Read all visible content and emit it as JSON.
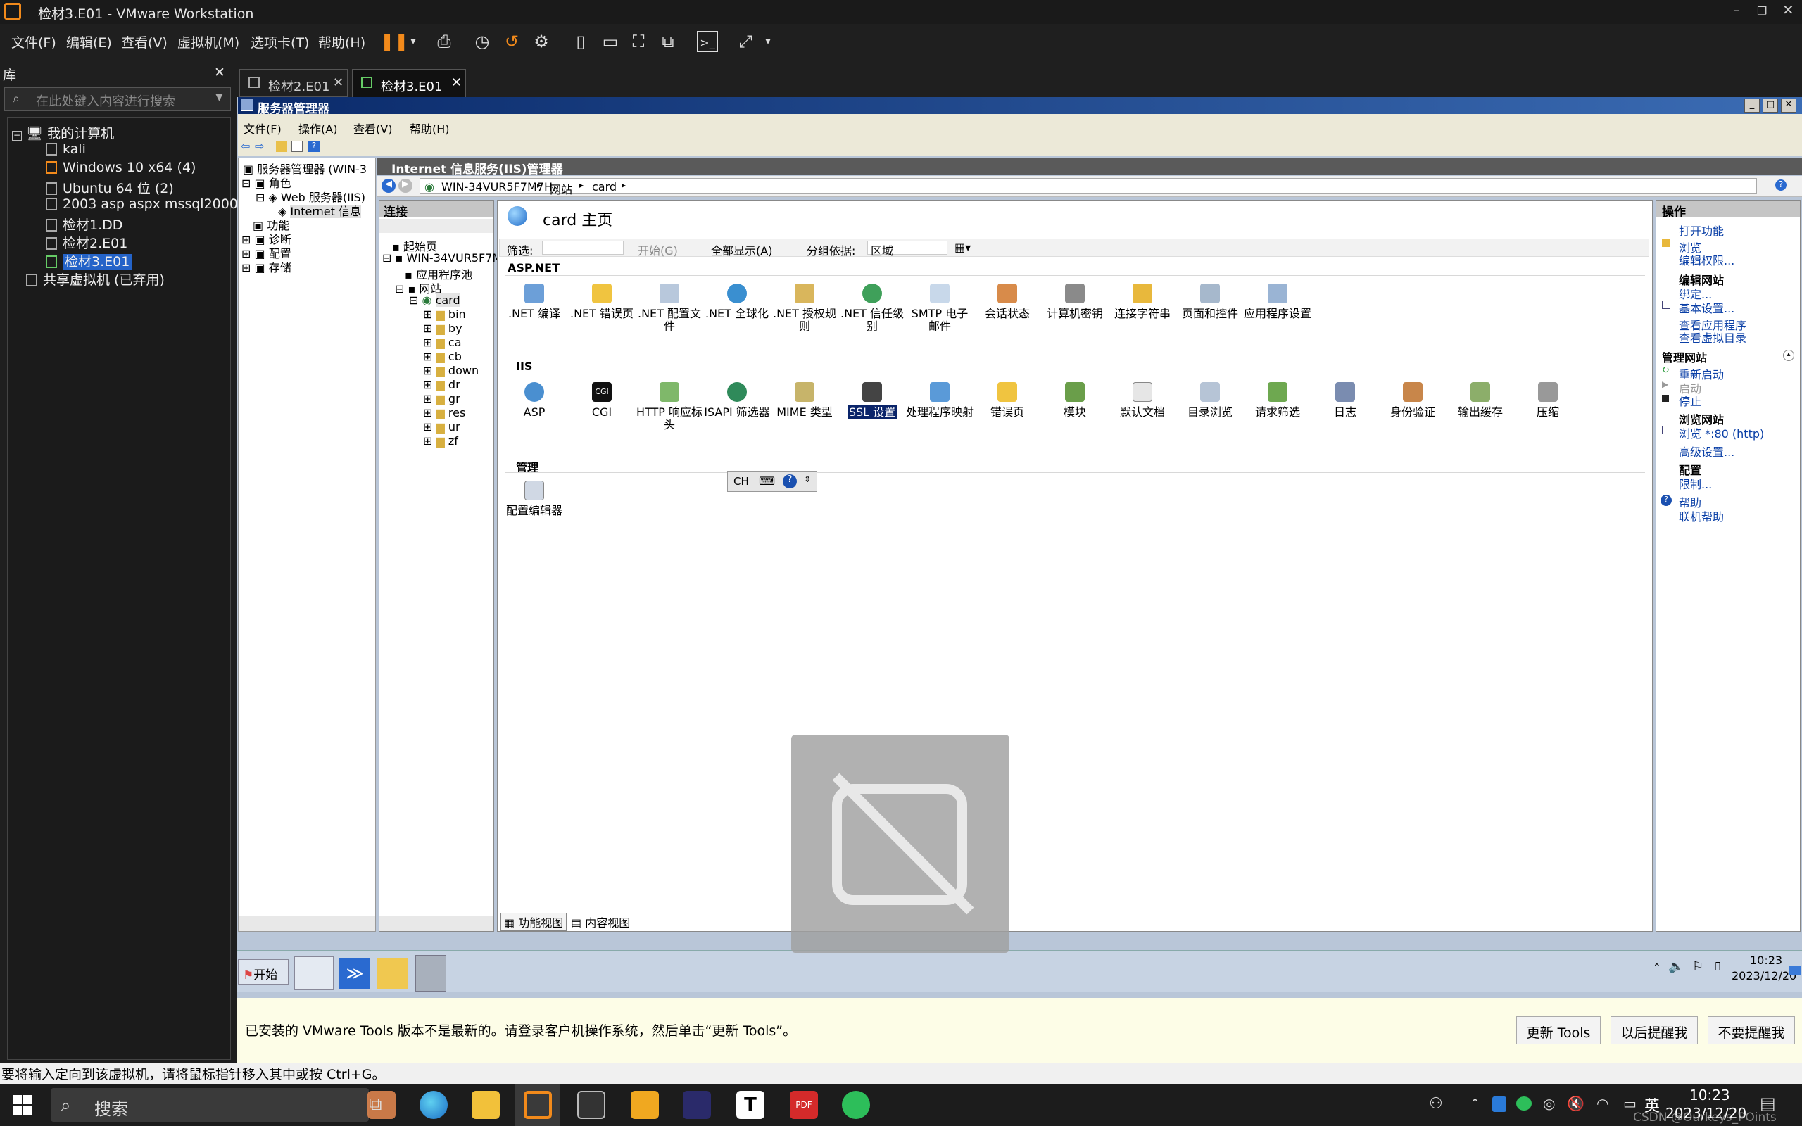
{
  "vmware": {
    "title": "检材3.E01 - VMware Workstation",
    "menu": [
      "文件(F)",
      "编辑(E)",
      "查看(V)",
      "虚拟机(M)",
      "选项卡(T)",
      "帮助(H)"
    ],
    "window_controls": [
      "–",
      "❐",
      "✕"
    ]
  },
  "library": {
    "header": "库",
    "close": "✕",
    "search_placeholder": "在此处键入内容进行搜索",
    "root": "我的计算机",
    "items": [
      "kali",
      "Windows 10 x64 (4)",
      "Ubuntu 64 位 (2)",
      "2003 asp aspx mssql2000",
      "检材1.DD",
      "检材2.E01",
      "检材3.E01"
    ],
    "selected": "检材3.E01",
    "shared": "共享虚拟机 (已弃用)"
  },
  "tabs": [
    {
      "label": "检材2.E01",
      "close": "✕"
    },
    {
      "label": "检材3.E01",
      "close": "✕"
    }
  ],
  "server_manager": {
    "title": "服务器管理器",
    "menu": [
      "文件(F)",
      "操作(A)",
      "查看(V)",
      "帮助(H)"
    ],
    "tree": [
      "服务器管理器 (WIN-3",
      "角色",
      "Web 服务器(IIS)",
      "Internet 信息",
      "功能",
      "诊断",
      "配置",
      "存储"
    ]
  },
  "iis": {
    "title": "Internet 信息服务(IIS)管理器",
    "breadcrumb": [
      "WIN-34VUR5F7M7H",
      "网站",
      "card"
    ],
    "connections_header": "连接",
    "connections": [
      "起始页",
      "WIN-34VUR5F7M",
      "应用程序池",
      "网站",
      "card",
      "bin",
      "by",
      "ca",
      "cb",
      "down",
      "dr",
      "gr",
      "res",
      "ur",
      "zf"
    ],
    "page_title": "card 主页",
    "filter": {
      "label": "筛选:",
      "start": "开始(G)",
      "show_all": "全部显示(A)",
      "group_label": "分组依据:",
      "group_value": "区域"
    },
    "sections": [
      {
        "name": "ASP.NET",
        "items": [
          ".NET 编译",
          ".NET 错误页",
          ".NET 配置文件",
          ".NET 全球化",
          ".NET 授权规则",
          ".NET 信任级别",
          "SMTP 电子邮件",
          "会话状态",
          "计算机密钥",
          "连接字符串",
          "页面和控件",
          "应用程序设置"
        ]
      },
      {
        "name": "IIS",
        "items": [
          "ASP",
          "CGI",
          "HTTP 响应标头",
          "ISAPI 筛选器",
          "MIME 类型",
          "SSL 设置",
          "处理程序映射",
          "错误页",
          "模块",
          "默认文档",
          "目录浏览",
          "请求筛选",
          "日志",
          "身份验证",
          "输出缓存",
          "压缩"
        ]
      },
      {
        "name": "管理",
        "items": [
          "配置编辑器"
        ]
      }
    ],
    "selected_feature": "SSL 设置",
    "ime": [
      "CH"
    ],
    "view_tabs": [
      "功能视图",
      "内容视图"
    ],
    "actions_header": "操作",
    "actions": [
      {
        "type": "link",
        "text": "打开功能"
      },
      {
        "type": "link",
        "text": "浏览"
      },
      {
        "type": "link",
        "text": "编辑权限..."
      },
      {
        "type": "head",
        "text": "编辑网站"
      },
      {
        "type": "link",
        "text": "绑定..."
      },
      {
        "type": "link",
        "text": "基本设置..."
      },
      {
        "type": "link",
        "text": "查看应用程序"
      },
      {
        "type": "link",
        "text": "查看虚拟目录"
      },
      {
        "type": "head",
        "text": "管理网站"
      },
      {
        "type": "link",
        "text": "重新启动"
      },
      {
        "type": "disabled",
        "text": "启动"
      },
      {
        "type": "link",
        "text": "停止"
      },
      {
        "type": "head",
        "text": "浏览网站"
      },
      {
        "type": "link",
        "text": "浏览 *:80 (http)"
      },
      {
        "type": "link",
        "text": "高级设置..."
      },
      {
        "type": "head",
        "text": "配置"
      },
      {
        "type": "link",
        "text": "限制..."
      },
      {
        "type": "link",
        "text": "帮助"
      },
      {
        "type": "link",
        "text": "联机帮助"
      }
    ]
  },
  "guest_taskbar": {
    "start": "开始",
    "time": "10:23",
    "date": "2023/12/20"
  },
  "notice": {
    "text": "已安装的 VMware Tools 版本不是最新的。请登录客户机操作系统，然后单击“更新 Tools”。",
    "buttons": [
      "更新 Tools",
      "以后提醒我",
      "不要提醒我"
    ]
  },
  "status_bar": "要将输入定向到该虚拟机，请将鼠标指针移入其中或按 Ctrl+G。",
  "windows_taskbar": {
    "search": "搜索",
    "ime": "英",
    "time": "10:23",
    "date": "2023/12/20",
    "watermark": "CSDN @Ourkeys_POints"
  },
  "colors": {
    "accent": "#2463c8",
    "vm_orange": "#f28a1b",
    "link": "#0a3fa6"
  }
}
